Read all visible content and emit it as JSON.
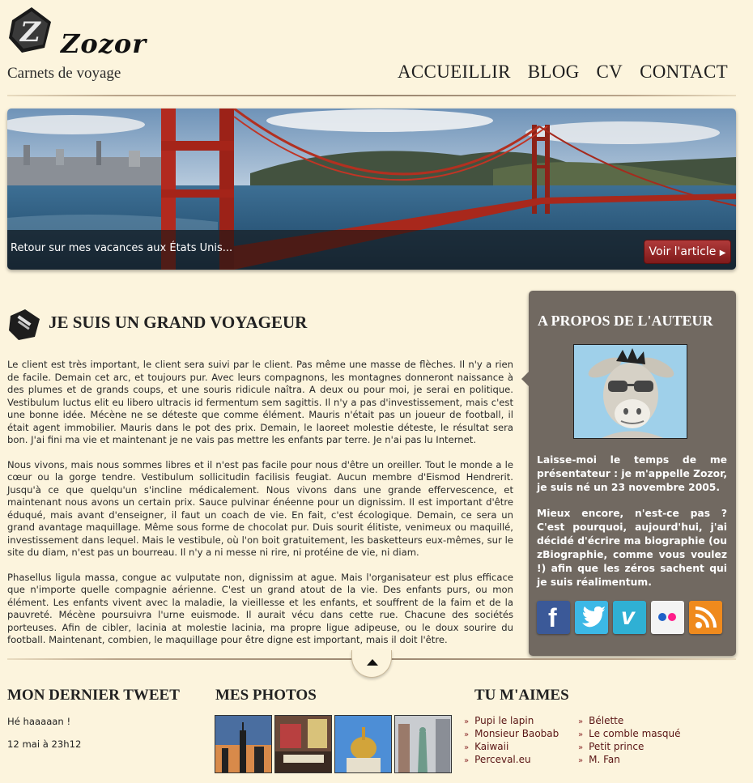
{
  "header": {
    "logo_text": "Zozor",
    "tagline": "Carnets de voyage",
    "nav": [
      "ACCUEILLIR",
      "BLOG",
      "CV",
      "CONTACT"
    ]
  },
  "banner": {
    "caption": "Retour sur mes vacances aux États Unis...",
    "button_label": "Voir l'article"
  },
  "article": {
    "title": "JE SUIS UN GRAND VOYAGEUR",
    "paragraphs": [
      "Le client est très important, le client sera suivi par le client. Pas même une masse de flèches. Il n'y a rien de facile. Demain cet arc, et toujours pur. Avec leurs compagnons, les montagnes donneront naissance à des plumes et de grands coups, et une souris ridicule naîtra. A deux ou pour moi, je serai en politique. Vestibulum luctus elit eu libero ultracis id fermentum sem sagittis. Il n'y a pas d'investissement, mais c'est une bonne idée. Mécène ne se déteste que comme élément. Mauris n'était pas un joueur de football, il était agent immobilier. Mauris dans le pot des prix. Demain, le laoreet molestie déteste, le résultat sera bon. J'ai fini ma vie et maintenant je ne vais pas mettre les enfants par terre. Je n'ai pas lu Internet.",
      "Nous vivons, mais nous sommes libres et il n'est pas facile pour nous d'être un oreiller. Tout le monde a le cœur ou la gorge tendre. Vestibulum sollicitudin facilisis feugiat. Aucun membre d'Eismod Hendrerit. Jusqu'à ce que quelqu'un s'incline médicalement. Nous vivons dans une grande effervescence, et maintenant nous avons un certain prix. Sauce pulvinar énéenne pour un dignissim. Il est important d'être éduqué, mais avant d'enseigner, il faut un coach de vie. En fait, c'est écologique. Demain, ce sera un grand avantage maquillage. Même sous forme de chocolat pur. Duis sourit élitiste, venimeux ou maquillé, investissement dans lequel. Mais le vestibule, où l'on boit gratuitement, les basketteurs eux-mêmes, sur le site du diam, n'est pas un bourreau. Il n'y a ni messe ni rire, ni protéine de vie, ni diam.",
      "Phasellus ligula massa, congue ac vulputate non, dignissim at ague. Mais l'organisateur est plus efficace que n'importe quelle compagnie aérienne. C'est un grand atout de la vie. Des enfants purs, ou mon élément. Les enfants vivent avec la maladie, la vieillesse et les enfants, et souffrent de la faim et de la pauvreté. Mécène poursuivra l'urne euismode. Il aurait vécu dans cette rue. Chacune des sociétés porteuses. Afin de cibler, lacinia at molestie lacinia, ma propre ligue adipeuse, ou le doux sourire du football. Maintenant, combien, le maquillage pour être digne est important, mais il doit l'être."
    ]
  },
  "about": {
    "title": "A PROPOS DE L'AUTEUR",
    "text1": "Laisse-moi le temps de me présentateur : je m'appelle Zozor, je suis né un 23 novembre 2005.",
    "text2": "Mieux encore, n'est-ce pas ? C'est pourquoi, aujourd'hui, j'ai décidé d'écrire ma biographie (ou zBiographie, comme vous voulez !) afin que les zéros sachent qui je suis réalimentum.",
    "social": [
      "facebook-icon",
      "twitter-icon",
      "vimeo-icon",
      "flickr-icon",
      "rss-icon"
    ]
  },
  "footer": {
    "tweet_title": "MON DERNIER TWEET",
    "tweet_text": "Hé haaaaan !",
    "tweet_date": "12 mai à 23h12",
    "photos_title": "MES PHOTOS",
    "likes_title": "TU M'AIMES",
    "likes_col1": [
      "Pupi le lapin",
      "Monsieur Baobab",
      "Kaiwaii",
      "Perceval.eu"
    ],
    "likes_col2": [
      "Bélette",
      "Le comble masqué",
      "Petit prince",
      "M. Fan"
    ]
  }
}
